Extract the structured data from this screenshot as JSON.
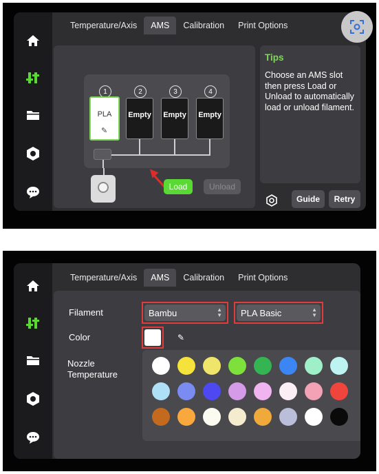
{
  "tabs": [
    {
      "label": "Temperature/Axis"
    },
    {
      "label": "AMS"
    },
    {
      "label": "Calibration"
    },
    {
      "label": "Print Options"
    }
  ],
  "screen1": {
    "slots": [
      {
        "number": "1",
        "label": "PLA"
      },
      {
        "number": "2",
        "label": "Empty"
      },
      {
        "number": "3",
        "label": "Empty"
      },
      {
        "number": "4",
        "label": "Empty"
      }
    ],
    "load_label": "Load",
    "unload_label": "Unload",
    "tips_title": "Tips",
    "tips_text": "Choose an AMS slot then press Load or Unload to automatically load or unload filament.",
    "guide_label": "Guide",
    "retry_label": "Retry"
  },
  "screen2": {
    "filament_label": "Filament",
    "brand_value": "Bambu",
    "type_value": "PLA Basic",
    "color_label": "Color",
    "nozzle_label_1": "Nozzle",
    "nozzle_label_2": "Temperature",
    "palette": [
      "#ffffff",
      "#f5e23a",
      "#efe56a",
      "#7ee03a",
      "#35b452",
      "#3b86f2",
      "#9ff0c8",
      "#bdf4f2",
      "#aee1f7",
      "#7a8cf2",
      "#4d48f2",
      "#d69be8",
      "#f0b4f0",
      "#fbeef4",
      "#f2a2b4",
      "#f0453c",
      "#c36a1e",
      "#f8a83c",
      "#fbfbf2",
      "#f5ebcf",
      "#f0aa3c",
      "#bbbed8",
      "#ffffff",
      "#0a0a0a"
    ]
  },
  "colors": {
    "accent_green": "#5ad834",
    "highlight_red": "#e23b3b"
  },
  "icons": [
    "home-icon",
    "control-icon",
    "folder-icon",
    "settings-icon",
    "chat-icon",
    "scan-icon",
    "gear-icon",
    "pencil-icon"
  ]
}
